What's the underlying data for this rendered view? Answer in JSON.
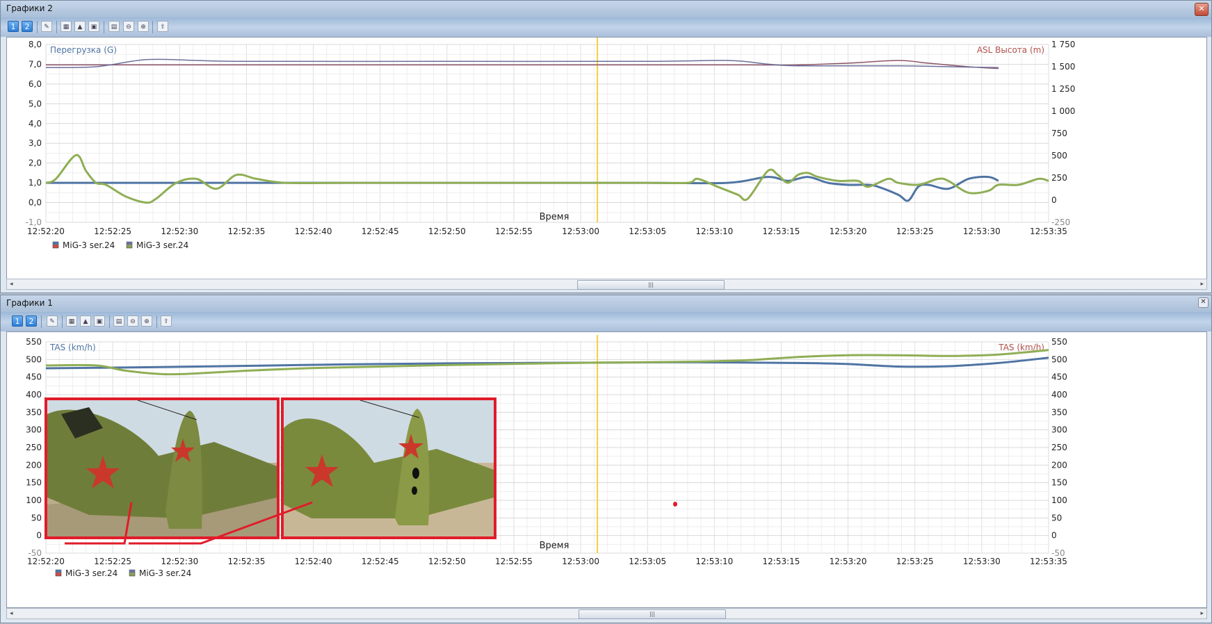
{
  "windows": [
    {
      "title": "Графики 2",
      "close_label": "✕",
      "toolbar": {
        "btn1": "1",
        "btn2": "2"
      },
      "chart": {
        "left_label": "Перегрузка (G)",
        "right_label": "ASL Высота (m)",
        "x_axis_label": "Время",
        "left_ticks": [
          "8,0",
          "7,0",
          "6,0",
          "5,0",
          "4,0",
          "3,0",
          "2,0",
          "1,0",
          "0,0",
          "-1,0"
        ],
        "right_ticks": [
          "1 750",
          "1 500",
          "1 250",
          "1 000",
          "750",
          "500",
          "250",
          "0",
          "-250"
        ],
        "x_ticks": [
          "12:52:20",
          "12:52:25",
          "12:52:30",
          "12:52:35",
          "12:52:40",
          "12:52:45",
          "12:52:50",
          "12:52:55",
          "12:53:00",
          "12:53:05",
          "12:53:10",
          "12:53:15",
          "12:53:20",
          "12:53:25",
          "12:53:30",
          "12:53:35"
        ],
        "legend": [
          {
            "name": "MiG-3 ser.24",
            "color": "#c8504a"
          },
          {
            "name": "MiG-3 ser.24",
            "color": "#8aa05a"
          }
        ]
      }
    },
    {
      "title": "Графики 1",
      "close_label": "✕",
      "toolbar": {
        "btn1": "1",
        "btn2": "2"
      },
      "chart": {
        "left_label": "TAS (km/h)",
        "right_label": "TAS (km/h)",
        "x_axis_label": "Время",
        "left_ticks": [
          "550",
          "500",
          "450",
          "400",
          "350",
          "300",
          "250",
          "200",
          "150",
          "100",
          "50",
          "0",
          "-50"
        ],
        "right_ticks": [
          "550",
          "500",
          "450",
          "400",
          "350",
          "300",
          "250",
          "200",
          "150",
          "100",
          "50",
          "0",
          "-50"
        ],
        "x_ticks": [
          "12:52:20",
          "12:52:25",
          "12:52:30",
          "12:52:35",
          "12:52:40",
          "12:52:45",
          "12:52:50",
          "12:52:55",
          "12:53:00",
          "12:53:05",
          "12:53:10",
          "12:53:15",
          "12:53:20",
          "12:53:25",
          "12:53:30",
          "12:53:35"
        ],
        "legend": [
          {
            "name": "MiG-3 ser.24",
            "color": "#c8504a"
          },
          {
            "name": "MiG-3 ser.24",
            "color": "#8aa05a"
          }
        ]
      }
    }
  ],
  "colors": {
    "blue_series": "#4f74a3",
    "green_series": "#8fae55",
    "altitude_a": "#8e5468",
    "altitude_b": "#6b6f9a",
    "cursor": "#f4d03f",
    "annotation": "#e11c2a",
    "left_label": "#4f74a3",
    "right_label": "#b0504a"
  },
  "chart_data": [
    {
      "type": "line",
      "x_unit": "time",
      "x_range": [
        "12:52:20",
        "12:53:35"
      ],
      "ylim_left": [
        -1.0,
        8.0
      ],
      "ylim_right": [
        -250,
        1750
      ],
      "cursor_x": 55,
      "grid": true,
      "legend_position": "bottom-left",
      "series": [
        {
          "axis": "left",
          "color": "#4f74a3",
          "points": [
            [
              0,
              1.0
            ],
            [
              10,
              1.0
            ],
            [
              20,
              1.0
            ],
            [
              30,
              1.0
            ],
            [
              40,
              1.0
            ],
            [
              50,
              1.0
            ],
            [
              60,
              1.0
            ],
            [
              68,
              1.0
            ],
            [
              72,
              1.3
            ],
            [
              74,
              1.1
            ],
            [
              76,
              1.3
            ],
            [
              78,
              1.0
            ],
            [
              80,
              0.9
            ],
            [
              82,
              0.9
            ],
            [
              83,
              0.8
            ],
            [
              85,
              0.4
            ],
            [
              86,
              0.1
            ],
            [
              87,
              0.8
            ],
            [
              88,
              0.9
            ],
            [
              90,
              0.7
            ],
            [
              92,
              1.2
            ],
            [
              94,
              1.3
            ],
            [
              95,
              1.1
            ]
          ]
        },
        {
          "axis": "left",
          "color": "#8fae55",
          "points": [
            [
              0,
              1.0
            ],
            [
              1,
              1.2
            ],
            [
              3,
              2.4
            ],
            [
              4,
              1.6
            ],
            [
              5,
              1.0
            ],
            [
              6,
              0.9
            ],
            [
              8,
              0.3
            ],
            [
              10,
              0.0
            ],
            [
              11,
              0.2
            ],
            [
              13,
              1.0
            ],
            [
              15,
              1.2
            ],
            [
              17,
              0.7
            ],
            [
              19,
              1.4
            ],
            [
              21,
              1.2
            ],
            [
              24,
              1.0
            ],
            [
              30,
              1.0
            ],
            [
              40,
              1.0
            ],
            [
              50,
              1.0
            ],
            [
              60,
              1.0
            ],
            [
              64,
              1.0
            ],
            [
              65,
              1.2
            ],
            [
              67,
              0.8
            ],
            [
              69,
              0.4
            ],
            [
              70,
              0.2
            ],
            [
              72,
              1.6
            ],
            [
              73,
              1.4
            ],
            [
              74,
              1.0
            ],
            [
              75,
              1.4
            ],
            [
              76,
              1.5
            ],
            [
              77,
              1.3
            ],
            [
              79,
              1.1
            ],
            [
              81,
              1.1
            ],
            [
              82,
              0.8
            ],
            [
              84,
              1.2
            ],
            [
              85,
              1.0
            ],
            [
              87,
              0.9
            ],
            [
              89,
              1.2
            ],
            [
              90,
              1.1
            ],
            [
              92,
              0.5
            ],
            [
              94,
              0.6
            ],
            [
              95,
              0.9
            ],
            [
              97,
              0.9
            ],
            [
              99,
              1.2
            ],
            [
              100,
              1.1
            ]
          ]
        },
        {
          "axis": "right",
          "color": "#8e5468",
          "points": [
            [
              0,
              1520
            ],
            [
              20,
              1520
            ],
            [
              40,
              1520
            ],
            [
              60,
              1520
            ],
            [
              70,
              1520
            ],
            [
              75,
              1520
            ],
            [
              80,
              1540
            ],
            [
              85,
              1570
            ],
            [
              88,
              1540
            ],
            [
              92,
              1500
            ],
            [
              95,
              1480
            ]
          ]
        },
        {
          "axis": "right",
          "color": "#6b6f9a",
          "points": [
            [
              0,
              1490
            ],
            [
              5,
              1500
            ],
            [
              10,
              1580
            ],
            [
              15,
              1570
            ],
            [
              20,
              1560
            ],
            [
              40,
              1560
            ],
            [
              60,
              1560
            ],
            [
              68,
              1570
            ],
            [
              72,
              1530
            ],
            [
              75,
              1510
            ],
            [
              85,
              1510
            ],
            [
              90,
              1500
            ],
            [
              95,
              1490
            ]
          ]
        }
      ]
    },
    {
      "type": "line",
      "x_unit": "time",
      "x_range": [
        "12:52:20",
        "12:53:35"
      ],
      "ylim": [
        -50,
        550
      ],
      "cursor_x": 55,
      "grid": true,
      "legend_position": "bottom-left",
      "series": [
        {
          "color": "#4f74a3",
          "points": [
            [
              0,
              475
            ],
            [
              10,
              478
            ],
            [
              20,
              482
            ],
            [
              30,
              486
            ],
            [
              40,
              489
            ],
            [
              55,
              491
            ],
            [
              65,
              492
            ],
            [
              75,
              490
            ],
            [
              80,
              487
            ],
            [
              85,
              480
            ],
            [
              90,
              481
            ],
            [
              95,
              490
            ],
            [
              100,
              505
            ]
          ]
        },
        {
          "color": "#8fae55",
          "points": [
            [
              0,
              483
            ],
            [
              5,
              483
            ],
            [
              8,
              468
            ],
            [
              12,
              458
            ],
            [
              16,
              462
            ],
            [
              20,
              468
            ],
            [
              25,
              474
            ],
            [
              30,
              478
            ],
            [
              40,
              484
            ],
            [
              50,
              489
            ],
            [
              55,
              491
            ],
            [
              65,
              494
            ],
            [
              70,
              498
            ],
            [
              75,
              507
            ],
            [
              80,
              512
            ],
            [
              85,
              512
            ],
            [
              90,
              510
            ],
            [
              95,
              514
            ],
            [
              100,
              527
            ]
          ]
        }
      ]
    }
  ],
  "overlay_images": [
    {
      "caption": "",
      "description_name": "mig3-tail-before"
    },
    {
      "caption": "",
      "description_name": "mig3-tail-damaged"
    }
  ]
}
